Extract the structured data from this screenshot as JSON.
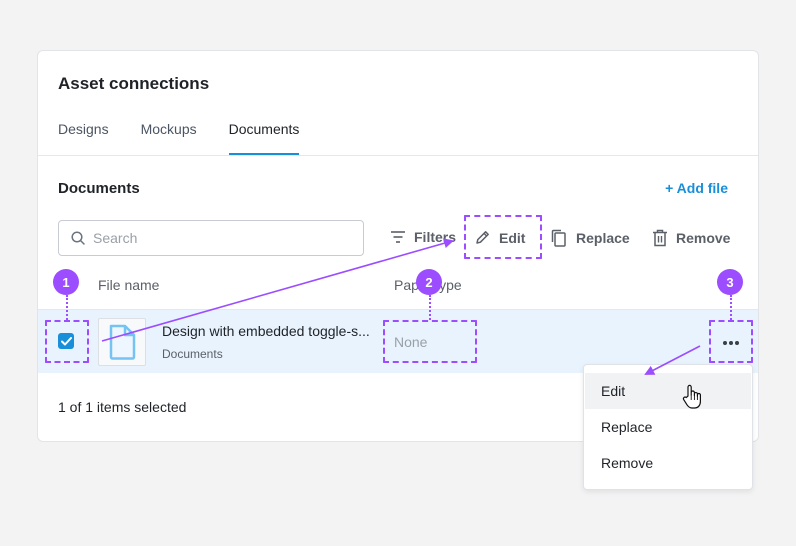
{
  "card": {
    "title": "Asset connections"
  },
  "tabs": [
    {
      "label": "Designs"
    },
    {
      "label": "Mockups"
    },
    {
      "label": "Documents"
    }
  ],
  "section": {
    "title": "Documents",
    "add_file": "+ Add file"
  },
  "search": {
    "placeholder": "Search",
    "value": ""
  },
  "toolbar": {
    "filters": "Filters",
    "edit": "Edit",
    "replace": "Replace",
    "remove": "Remove"
  },
  "table": {
    "columns": [
      "File name",
      "Paper type"
    ],
    "rows": [
      {
        "name": "Design with embedded toggle-s...",
        "subtitle": "Documents",
        "paper_type": "None",
        "selected": true
      }
    ]
  },
  "footer": {
    "selection_text": "1 of 1 items selected"
  },
  "context_menu": {
    "items": [
      "Edit",
      "Replace",
      "Remove"
    ],
    "hovered": "Edit"
  },
  "annotations": {
    "badges": [
      "1",
      "2",
      "3"
    ],
    "accent_color": "#9b4dff"
  },
  "colors": {
    "primary": "#1a8fd9",
    "selected_row": "#e8f3fd",
    "annotation": "#9b4dff"
  }
}
